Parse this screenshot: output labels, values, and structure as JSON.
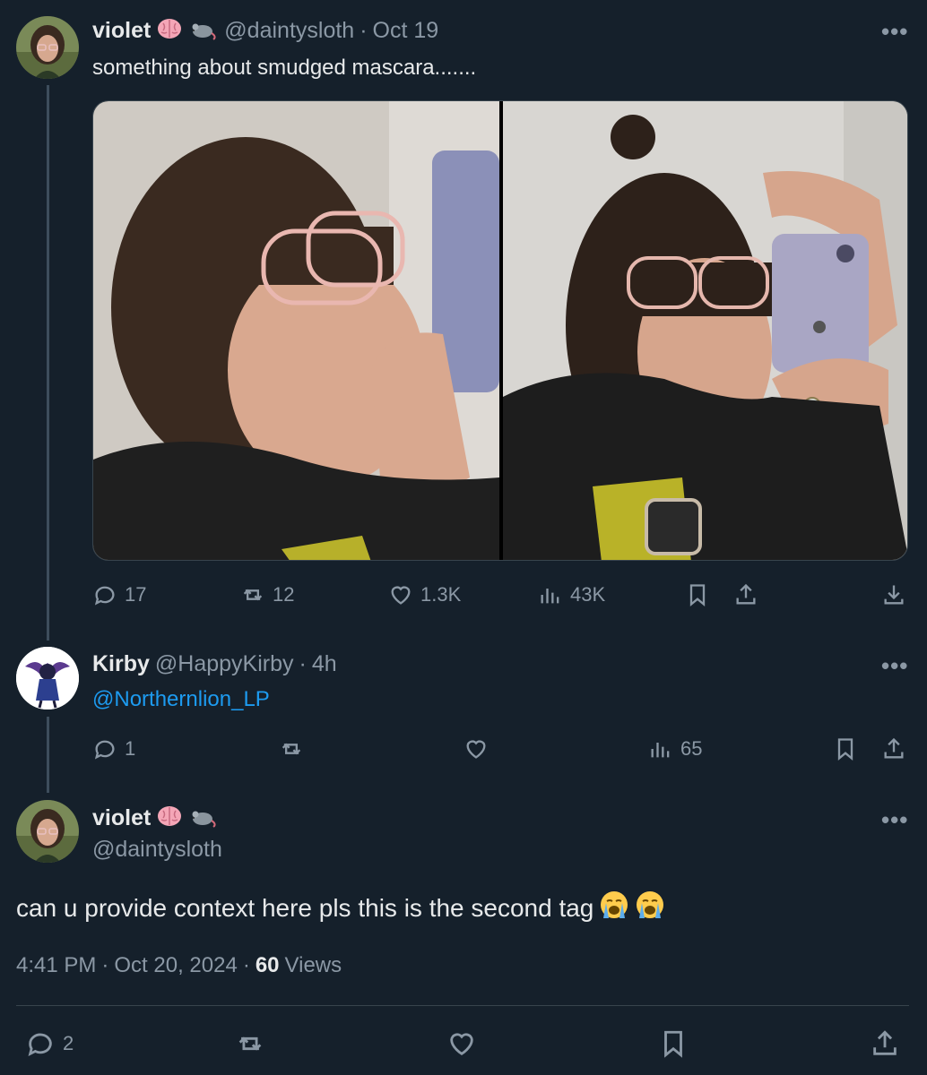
{
  "tweet1": {
    "name": "violet",
    "handle": "@daintysloth",
    "sep": "·",
    "date": "Oct 19",
    "text": "something about smudged mascara.......",
    "stats": {
      "replies": "17",
      "retweets": "12",
      "likes": "1.3K",
      "views": "43K"
    }
  },
  "tweet2": {
    "name": "Kirby",
    "handle": "@HappyKirby",
    "sep": "·",
    "date": "4h",
    "mention": "@Northernlion_LP",
    "stats": {
      "replies": "1",
      "views": "65"
    }
  },
  "tweet3": {
    "name": "violet",
    "handle": "@daintysloth",
    "text": "can u provide context here pls this is the second tag",
    "time": "4:41 PM",
    "date": "Oct 20, 2024",
    "sep1": "·",
    "sep2": "·",
    "views_count": "60",
    "views_label": "Views",
    "stats": {
      "replies": "2"
    }
  },
  "colors": {
    "background": "#15202b",
    "accent": "#1d9bf0",
    "muted": "#8b98a5"
  }
}
